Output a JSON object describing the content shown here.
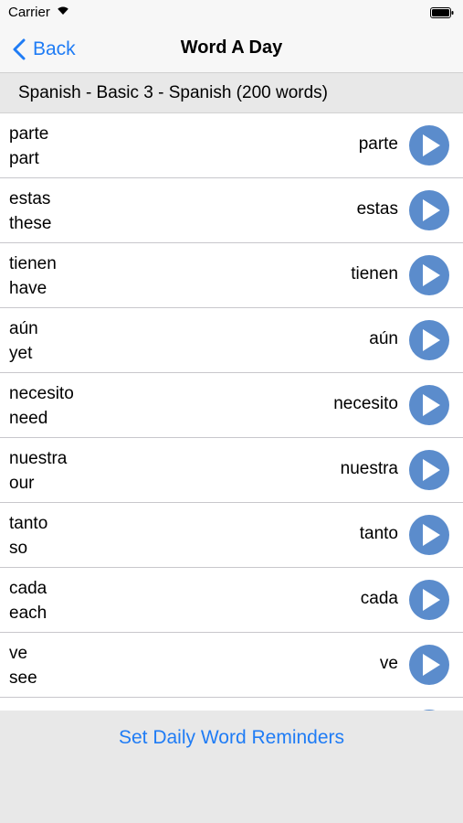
{
  "status_bar": {
    "carrier": "Carrier"
  },
  "nav": {
    "back_label": "Back",
    "title": "Word A Day"
  },
  "list_header": "Spanish - Basic 3 - Spanish (200 words)",
  "words": [
    {
      "spanish": "parte",
      "english": "part",
      "right": "parte"
    },
    {
      "spanish": "estas",
      "english": "these",
      "right": "estas"
    },
    {
      "spanish": "tienen",
      "english": "have",
      "right": "tienen"
    },
    {
      "spanish": "aún",
      "english": "yet",
      "right": "aún"
    },
    {
      "spanish": "necesito",
      "english": "need",
      "right": "necesito"
    },
    {
      "spanish": "nuestra",
      "english": "our",
      "right": "nuestra"
    },
    {
      "spanish": "tanto",
      "english": "so",
      "right": "tanto"
    },
    {
      "spanish": "cada",
      "english": "each",
      "right": "cada"
    },
    {
      "spanish": "ve",
      "english": "see",
      "right": "ve"
    }
  ],
  "bottom": {
    "reminder_label": "Set Daily Word Reminders"
  },
  "colors": {
    "accent": "#1f7cf5",
    "play_button": "#5b8ccc",
    "header_bg": "#e8e8e8"
  },
  "icons": {
    "back": "chevron-left-icon",
    "play": "play-icon",
    "wifi": "wifi-icon",
    "battery": "battery-icon"
  }
}
